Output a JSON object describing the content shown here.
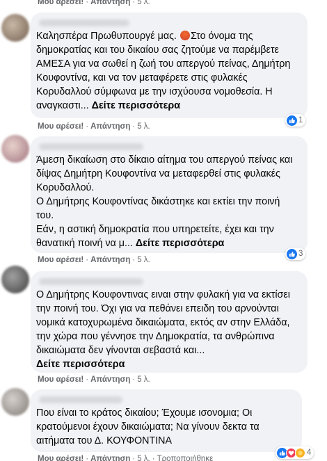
{
  "labels": {
    "like": "Μου αρέσει!",
    "reply": "Απάντηση",
    "see_more": "Δείτε περισσότερα",
    "edited": "Τροποποιήθηκε"
  },
  "comments": [
    {
      "avatar": "blurred-avatar",
      "time": "5 λ.",
      "line_a": "Καλησπέρα Πρωθυπουργέ μας.",
      "line_b": "Στο όνομα της δημοκρατίας και του δικαίου σας ζητούμε να παρέμβετε ΑΜΕΣΑ για να σωθεί η ζωή του απεργού πείνας, Δημήτρη Κουφοντίνα, και να τον μεταφέρετε στις φυλακές Κορυδαλλού σύμφωνα με την ισχύουσα νομοθεσία. Η αναγκαστι...",
      "emoji": "angry-face-icon",
      "reactions": "1"
    },
    {
      "avatar": "blurred-avatar",
      "time": "5 λ.",
      "text": "Άμεση δικαίωση στο δίκαιο αίτημα του απεργού πείνας και δίψας Δημήτρη Κουφοντίνα να μεταφερθεί στις φυλακές Κορυδαλλού.\nΟ Δημήτρης Κουφοντίνας δικάστηκε και εκτίει την ποινή του.\nΕάν, η αστική δημοκρατία που υπηρετείτε, έχει και την θανατική ποινή να μ...",
      "reactions": "3"
    },
    {
      "avatar": "blurred-avatar",
      "time": "5 λ.",
      "text": "Ο Δημήτρης Κουφοντινας ειναι στην φυλακή για να εκτίσει την ποινή του. Όχι για να πεθάνει επειδη του αρνούνται νομικά κατοχυρωμένα δικαιώματα, εκτός αν στην Ελλάδα, την χώρα που γέννησε την Δημοκρατία, τα ανθρώπινα δικαιώματα δεν γίνονται σεβαστά και..."
    },
    {
      "avatar": "blurred-avatar",
      "time": "5 λ.",
      "text": "Που είναι το κράτος δικαίου; Έχουμε ισονομια; Οι κρατούμενοι έχουν δικαιώματα; Να γίνουν δεκτα τα αιτήματα του Δ. ΚΟΥΦΟΝΤΙΝΑ",
      "reactions": "4"
    }
  ],
  "top_row": {
    "time": "5 λ."
  },
  "colors": {
    "bubble": "#f0f2f5",
    "meta": "#65676b",
    "like_blue": "#1877f2",
    "heart_red": "#f33e58",
    "care_yellow": "#f7b125"
  }
}
